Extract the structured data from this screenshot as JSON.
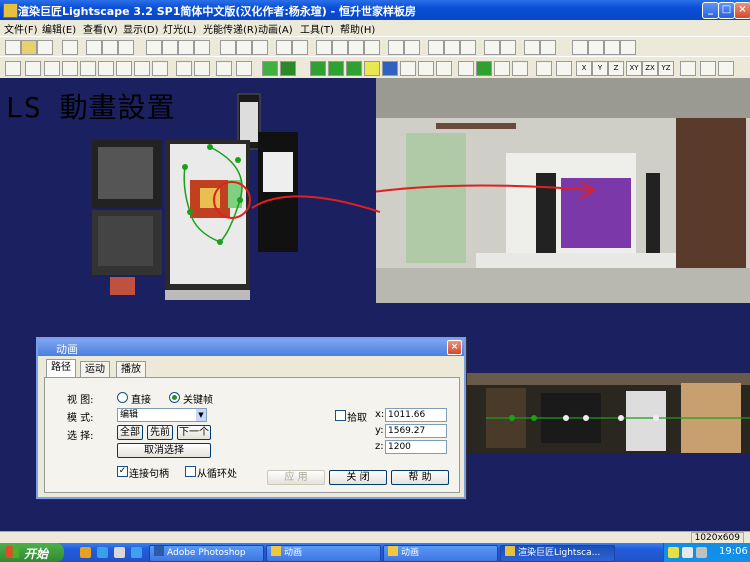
{
  "window": {
    "title": "渲染巨匠Lightscape 3.2 SP1简体中文版(汉化作者:杨永瑄) - 恒升世家样板房"
  },
  "menu": [
    "文件(F)",
    "编辑(E)",
    "查看(V)",
    "显示(D)",
    "灯光(L)",
    "光能传递(R)",
    "动画(A)",
    "工具(T)",
    "帮助(H)"
  ],
  "toolbar2_axis_labels": [
    "X",
    "Y",
    "Z",
    "XY",
    "ZX",
    "YZ"
  ],
  "workspace": {
    "overlay_text": "LS 動畫設置"
  },
  "dialog": {
    "title": "动画",
    "tabs": [
      "路径",
      "运动",
      "播放"
    ],
    "view_label": "视 图:",
    "view_options": [
      "直接",
      "关键帧"
    ],
    "view_selected": "关键帧",
    "mode_label": "模 式:",
    "mode_value": "编辑",
    "select_label": "选 择:",
    "select_buttons": [
      "全部",
      "先前",
      "下一个"
    ],
    "deselect_button": "取消选择",
    "connect_handles": {
      "label": "连接句柄",
      "checked": true
    },
    "from_loop": {
      "label": "从循环处",
      "checked": false
    },
    "pick": {
      "label": "拾取",
      "checked": false
    },
    "x_label": "x:",
    "x_value": "1011.66",
    "y_label": "y:",
    "y_value": "1569.27",
    "z_label": "z:",
    "z_value": "1200",
    "apply_button": "应 用",
    "close_button": "关 闭",
    "help_button": "帮 助"
  },
  "status": {
    "resolution": "1020x609"
  },
  "taskbar": {
    "start_label": "开始",
    "tasks": [
      {
        "label": "Adobe Photoshop",
        "active": false
      },
      {
        "label": "动画",
        "active": false
      },
      {
        "label": "动画",
        "active": false
      },
      {
        "label": "渲染巨匠Lightsca...",
        "active": true
      }
    ],
    "clock": "19:06"
  },
  "colors": {
    "titlebar": "#0a4fd6",
    "workspace": "#1b2060",
    "dialog_bg": "#ece9d8",
    "annotation_red": "#e02020"
  }
}
